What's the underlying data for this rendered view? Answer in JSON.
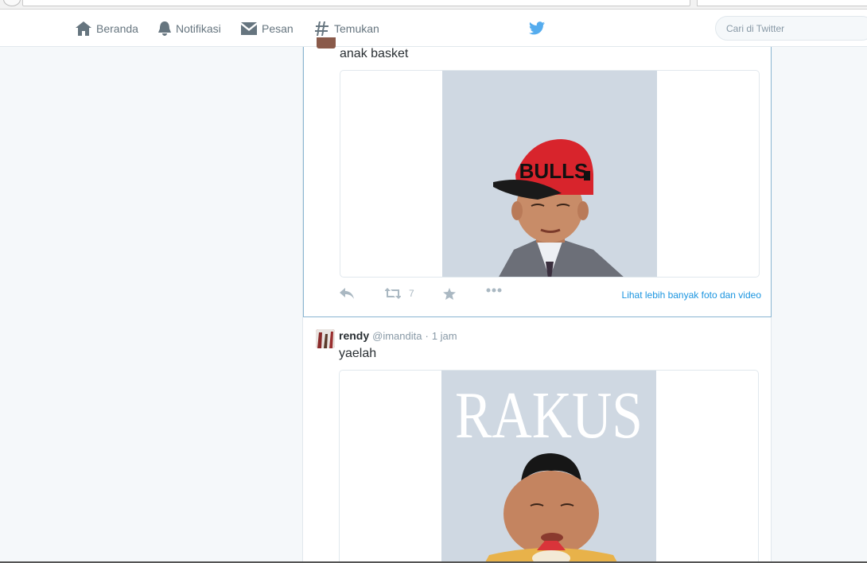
{
  "nav": {
    "home": "Beranda",
    "notifications": "Notifikasi",
    "messages": "Pesan",
    "discover": "Temukan"
  },
  "search": {
    "placeholder": "Cari di Twitter"
  },
  "tweet1": {
    "text": "anak basket",
    "cap_text": "BULLS",
    "retweets": "7",
    "more_link": "Lihat lebih banyak foto dan video"
  },
  "tweet2": {
    "name": "rendy",
    "handle": "@imandita",
    "dot": "·",
    "time": "1 jam",
    "text": "yaelah",
    "image_caption": "RAKUS"
  },
  "colors": {
    "accent": "#1b95e0",
    "bird": "#55acee",
    "muted": "#8899a6",
    "focus_border": "#8ab5d1"
  }
}
